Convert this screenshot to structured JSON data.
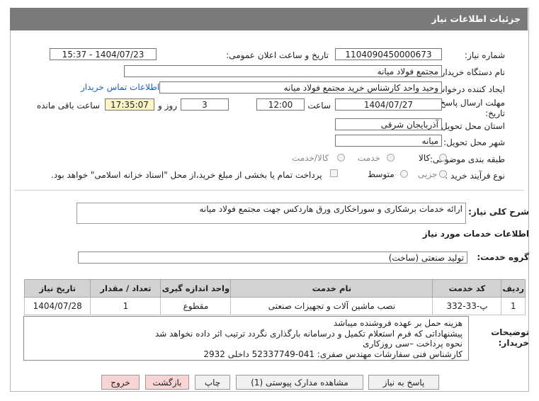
{
  "header": {
    "title": "جزئیات اطلاعات نیاز"
  },
  "form": {
    "need_number_label": "شماره نیاز:",
    "need_number": "1104090450000673",
    "announce_label": "تاریخ و ساعت اعلان عمومی:",
    "announce_value": "1404/07/23 - 15:37",
    "buyer_org_label": "نام دستگاه خریدار:",
    "buyer_org": "مجتمع فولاد میانه",
    "creator_label": "ایجاد کننده درخواست:",
    "creator": "وحید واحد کارشناس خرید مجتمع فولاد میانه",
    "contact_link": "اطلاعات تماس خریدار",
    "deadline_label_1": "مهلت ارسال پاسخ: تا",
    "deadline_label_2": "تاریخ:",
    "deadline_date": "1404/07/27",
    "time_label": "ساعت",
    "deadline_time": "12:00",
    "days_value": "3",
    "days_label": "روز و",
    "remaining_time": "17:35:07",
    "remaining_label": "ساعت باقی مانده",
    "province_label": "استان محل تحویل:",
    "province": "آذربایجان شرقی",
    "city_label": "شهر محل تحویل:",
    "city": "میانه",
    "category_label": "طبقه بندی موضوعی:",
    "category_options": [
      "کالا",
      "خدمت",
      "کالا/خدمت"
    ],
    "process_label": "نوع فرآیند خرید :",
    "process_options": [
      "جزیی",
      "متوسط"
    ],
    "treasury_text": "پرداخت تمام یا بخشی از مبلغ خرید،از محل \"اسناد خزانه اسلامی\" خواهد بود."
  },
  "description": {
    "label": "شرح کلی نیاز:",
    "value": "ارائه خدمات برشکاری و سوراخکاری ورق هاردکس جهت مجتمع فولاد میانه"
  },
  "services": {
    "section_title": "اطلاعات خدمات مورد نیاز",
    "group_label": "گروه خدمت:",
    "group_value": "تولید صنعتی (ساخت)",
    "columns": [
      "ردیف",
      "کد خدمت",
      "نام خدمت",
      "واحد اندازه گیری",
      "تعداد / مقدار",
      "تاریخ نیاز"
    ],
    "rows": [
      {
        "row": "1",
        "code": "پ-33-332",
        "name": "نصب ماشین آلات و تجهیزات صنعتی",
        "unit": "مقطوع",
        "qty": "1",
        "date": "1404/07/28"
      }
    ]
  },
  "notes": {
    "label_1": "توضیحات",
    "label_2": "خریدار:",
    "lines": [
      "هزینه حمل بر عهده فروشنده میباشد",
      "پیشنهاداتی که فرم استعلام تکمیل و درسامانه بارگذاری نگردد ترتیب اثر داده نخواهد شد",
      "نحوه پرداخت –سی روزکاری",
      "کارشناس فنی سفارشات مهندس صفری:  041-52337749  داخلی 2932"
    ]
  },
  "buttons": {
    "reply": "پاسخ به نیاز",
    "attachments": "مشاهده مدارک پیوستی (1)",
    "print": "چاپ",
    "back": "بازگشت",
    "exit": "خروج"
  }
}
